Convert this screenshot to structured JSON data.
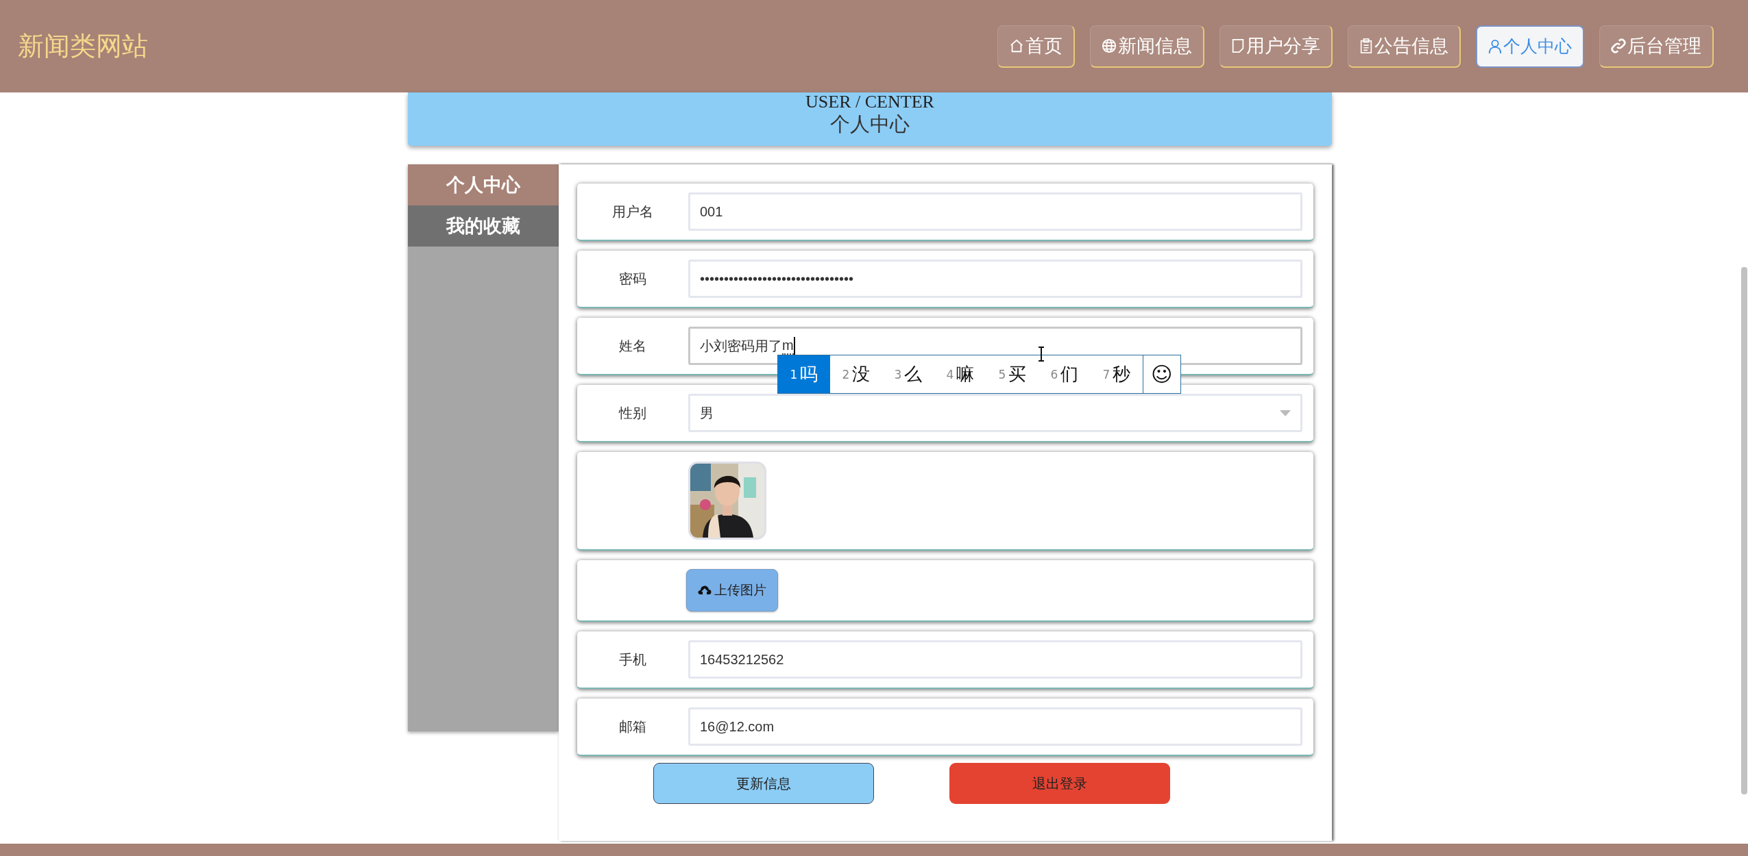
{
  "header": {
    "title": "新闻类网站",
    "nav": [
      {
        "label": "首页",
        "selected": false
      },
      {
        "label": "新闻信息",
        "selected": false
      },
      {
        "label": "用户分享",
        "selected": false
      },
      {
        "label": "公告信息",
        "selected": false
      },
      {
        "label": "个人中心",
        "selected": true
      },
      {
        "label": "后台管理",
        "selected": false
      }
    ]
  },
  "banner": {
    "subtitle": "USER / CENTER",
    "title": "个人中心"
  },
  "sidebar": {
    "items": [
      {
        "label": "个人中心",
        "selected": true
      },
      {
        "label": "我的收藏",
        "selected": false
      }
    ]
  },
  "form": {
    "rows": [
      {
        "kind": "text",
        "label": "用户名",
        "value": "001"
      },
      {
        "kind": "text",
        "label": "密码",
        "value": "••••••••••••••••••••••••••••••••"
      },
      {
        "kind": "text",
        "label": "姓名",
        "value": "小刘密码用了",
        "composition": "m"
      },
      {
        "kind": "select",
        "label": "性别",
        "value": "男"
      },
      {
        "kind": "picture"
      },
      {
        "kind": "upload",
        "button": "上传图片"
      },
      {
        "kind": "text",
        "label": "手机",
        "value": "16453212562"
      },
      {
        "kind": "text",
        "label": "邮箱",
        "value": "16@12.com"
      }
    ],
    "buttons": [
      {
        "label": "更新信息",
        "kind": "primary"
      },
      {
        "label": "退出登录",
        "kind": "danger"
      }
    ]
  },
  "ime": {
    "candidates": [
      {
        "number": "1",
        "text": "吗",
        "selected": true
      },
      {
        "number": "2",
        "text": "没",
        "selected": false
      },
      {
        "number": "3",
        "text": "么",
        "selected": false
      },
      {
        "number": "4",
        "text": "嘛",
        "selected": false
      },
      {
        "number": "5",
        "text": "买",
        "selected": false
      },
      {
        "number": "6",
        "text": "们",
        "selected": false
      },
      {
        "number": "7",
        "text": "秒",
        "selected": false
      }
    ],
    "emoji": "☺"
  }
}
